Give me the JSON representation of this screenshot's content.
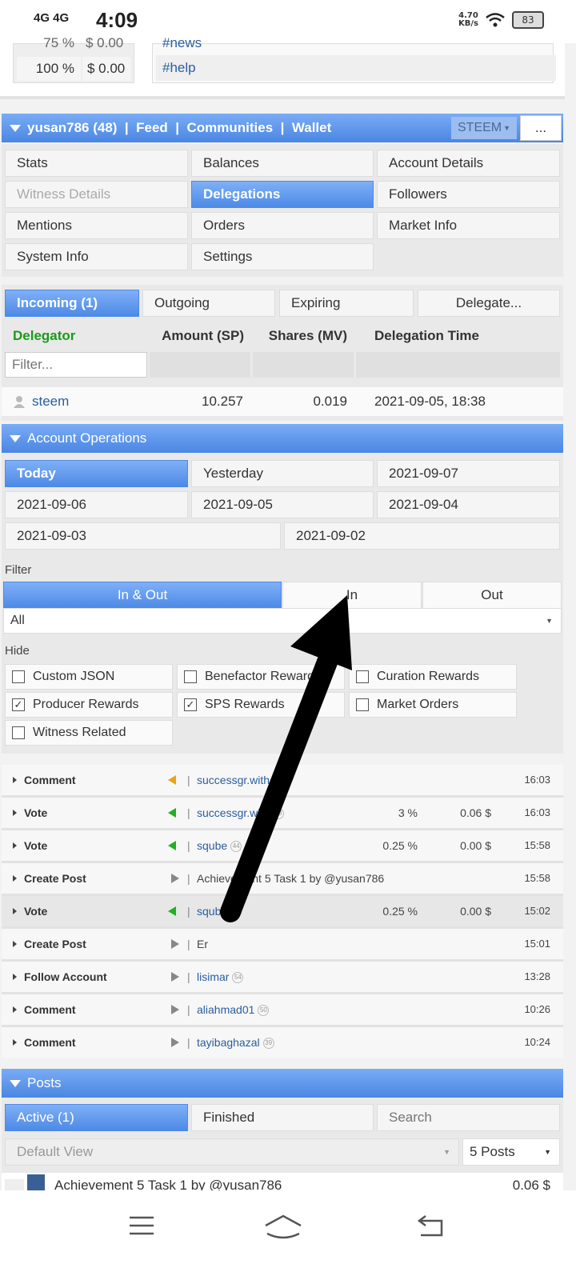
{
  "status": {
    "network": "4G 4G",
    "time": "4:09",
    "speed_value": "4.70",
    "speed_unit": "KB/s",
    "battery": "83"
  },
  "top": {
    "pct_partial": "75 %",
    "usd_partial": "$ 0.00",
    "pct": "100 %",
    "usd": "$ 0.00",
    "tag_partial": "#news",
    "tag": "#help"
  },
  "header": {
    "user": "yusan786 (48)",
    "sep": "|",
    "feed": "Feed",
    "communities": "Communities",
    "wallet": "Wallet",
    "currency": "STEEM",
    "more": "..."
  },
  "tabs": {
    "stats": "Stats",
    "balances": "Balances",
    "account_details": "Account Details",
    "witness_details": "Witness Details",
    "delegations": "Delegations",
    "followers": "Followers",
    "mentions": "Mentions",
    "orders": "Orders",
    "market_info": "Market Info",
    "system_info": "System Info",
    "settings": "Settings"
  },
  "delegations": {
    "tabs": {
      "incoming": "Incoming (1)",
      "outgoing": "Outgoing",
      "expiring": "Expiring",
      "delegate": "Delegate..."
    },
    "columns": {
      "delegator": "Delegator",
      "amount": "Amount (SP)",
      "shares": "Shares (MV)",
      "time": "Delegation Time"
    },
    "filter_placeholder": "Filter...",
    "rows": [
      {
        "delegator": "steem",
        "amount": "10.257",
        "shares": "0.019",
        "time": "2021-09-05, 18:38"
      }
    ]
  },
  "operations": {
    "title": "Account Operations",
    "dates": {
      "today": "Today",
      "yesterday": "Yesterday",
      "d0907": "2021-09-07",
      "d0906": "2021-09-06",
      "d0905": "2021-09-05",
      "d0904": "2021-09-04",
      "d0903": "2021-09-03",
      "d0902": "2021-09-02"
    },
    "filter_label": "Filter",
    "filter": {
      "inout": "In & Out",
      "in": "In",
      "out": "Out"
    },
    "type_select": "All",
    "hide_label": "Hide",
    "hide": [
      {
        "label": "Custom JSON",
        "checked": false
      },
      {
        "label": "Benefactor Rewards",
        "checked": false
      },
      {
        "label": "Curation Rewards",
        "checked": false
      },
      {
        "label": "Producer Rewards",
        "checked": true
      },
      {
        "label": "SPS Rewards",
        "checked": true
      },
      {
        "label": "Market Orders",
        "checked": false
      },
      {
        "label": "Witness Related",
        "checked": false
      }
    ],
    "rows": [
      {
        "type": "Comment",
        "icon": "orange-left",
        "text": "successgr.with",
        "rep": "",
        "pct": "",
        "usd": "",
        "time": "16:03"
      },
      {
        "type": "Vote",
        "icon": "green-left",
        "text": "successgr.with",
        "rep": "53",
        "pct": "3 %",
        "usd": "0.06 $",
        "time": "16:03"
      },
      {
        "type": "Vote",
        "icon": "green-left",
        "text": "sqube",
        "rep": "44",
        "pct": "0.25 %",
        "usd": "0.00 $",
        "time": "15:58"
      },
      {
        "type": "Create Post",
        "icon": "gray-right",
        "text": "Achievement 5 Task 1 by @yusan786",
        "rep": "",
        "pct": "",
        "usd": "",
        "time": "15:58"
      },
      {
        "type": "Vote",
        "icon": "green-left",
        "text": "sqube",
        "rep": "44",
        "pct": "0.25 %",
        "usd": "0.00 $",
        "time": "15:02"
      },
      {
        "type": "Create Post",
        "icon": "gray-right",
        "text": "Er",
        "rep": "",
        "pct": "",
        "usd": "",
        "time": "15:01"
      },
      {
        "type": "Follow Account",
        "icon": "gray-right",
        "text": "lisimar",
        "rep": "54",
        "pct": "",
        "usd": "",
        "time": "13:28"
      },
      {
        "type": "Comment",
        "icon": "gray-right",
        "text": "aliahmad01",
        "rep": "50",
        "pct": "",
        "usd": "",
        "time": "10:26"
      },
      {
        "type": "Comment",
        "icon": "gray-right",
        "text": "tayibaghazal",
        "rep": "39",
        "pct": "",
        "usd": "",
        "time": "10:24"
      }
    ]
  },
  "posts": {
    "title": "Posts",
    "tabs": {
      "active": "Active (1)",
      "finished": "Finished",
      "search": "Search"
    },
    "view_select": "Default View",
    "count_select": "5 Posts",
    "first_post": {
      "title": "Achievement 5 Task 1 by @yusan786",
      "value": "0.06 $"
    }
  }
}
